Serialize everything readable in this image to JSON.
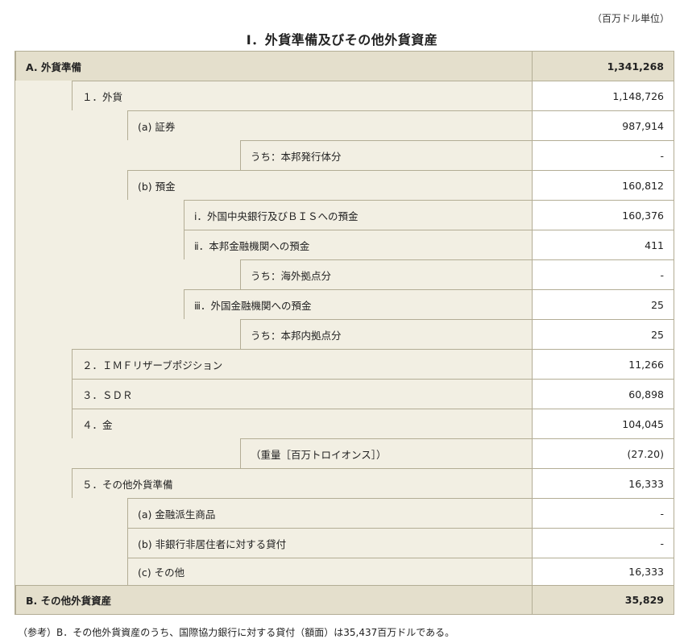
{
  "unit_note": "（百万ドル単位）",
  "title": "Ⅰ．外貨準備及びその他外貨資産",
  "rows": [
    {
      "label": "A. 外貨準備",
      "value": "1,341,268"
    },
    {
      "label": "１．外貨",
      "value": "1,148,726"
    },
    {
      "label": "(a) 証券",
      "value": "987,914"
    },
    {
      "label": "うち：本邦発行体分",
      "value": "-"
    },
    {
      "label": "(b) 預金",
      "value": "160,812"
    },
    {
      "label": "ⅰ．外国中央銀行及びＢＩＳへの預金",
      "value": "160,376"
    },
    {
      "label": "ⅱ．本邦金融機関への預金",
      "value": "411"
    },
    {
      "label": "うち：海外拠点分",
      "value": "-"
    },
    {
      "label": "ⅲ．外国金融機関への預金",
      "value": "25"
    },
    {
      "label": "うち：本邦内拠点分",
      "value": "25"
    },
    {
      "label": "２．ＩＭＦリザーブポジション",
      "value": "11,266"
    },
    {
      "label": "３．ＳＤＲ",
      "value": "60,898"
    },
    {
      "label": "４．金",
      "value": "104,045"
    },
    {
      "label": "（重量［百万トロイオンス］）",
      "value": "(27.20)"
    },
    {
      "label": "５．その他外貨準備",
      "value": "16,333"
    },
    {
      "label": "(a) 金融派生商品",
      "value": "-"
    },
    {
      "label": "(b) 非銀行非居住者に対する貸付",
      "value": "-"
    },
    {
      "label": "(c) その他",
      "value": "16,333"
    },
    {
      "label": "B. その他外貨資産",
      "value": "35,829"
    }
  ],
  "footnote": "（参考）B．その他外貨資産のうち、国際協力銀行に対する貸付（額面）は35,437百万ドルである。"
}
